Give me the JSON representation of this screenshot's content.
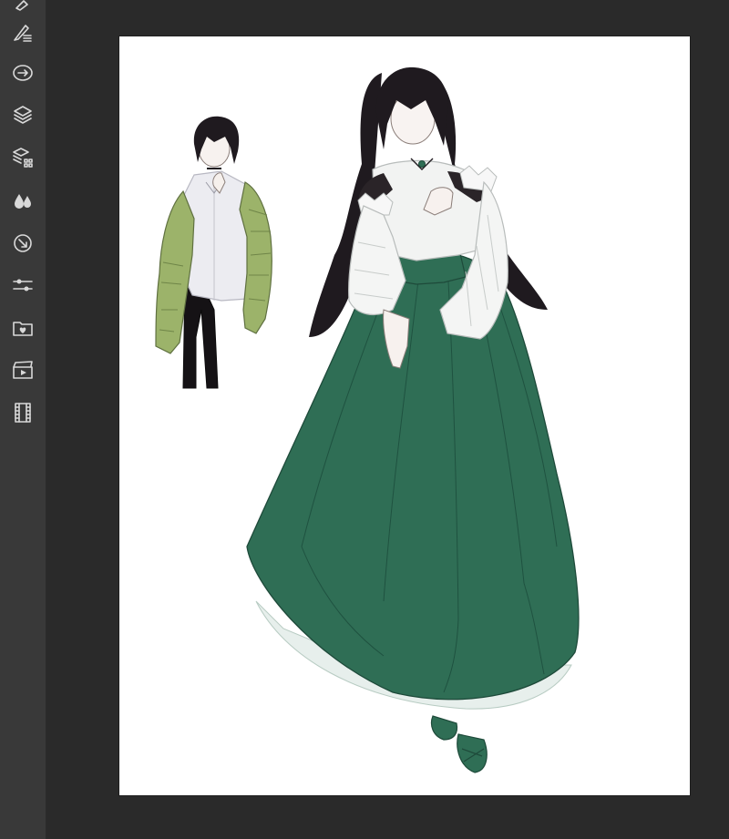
{
  "app": {
    "toolbar": {
      "tools": [
        {
          "name": "brush-partial-icon"
        },
        {
          "name": "brush-settings-icon"
        },
        {
          "name": "transform-icon"
        },
        {
          "name": "layers-icon"
        },
        {
          "name": "layer-effects-icon"
        },
        {
          "name": "color-drops-icon"
        },
        {
          "name": "reference-icon"
        },
        {
          "name": "adjustments-icon"
        },
        {
          "name": "favorites-folder-icon"
        },
        {
          "name": "animation-clapper-icon"
        },
        {
          "name": "filmstrip-icon"
        }
      ]
    },
    "canvas": {
      "background": "#ffffff",
      "colors": {
        "skirt_green": "#2f6e55",
        "jacket_green": "#9cb36a",
        "hair_black": "#1f1a1f",
        "shirt_white": "#efefef",
        "workspace_bg": "#2a2a2a",
        "sidebar_bg": "#393939"
      }
    }
  }
}
